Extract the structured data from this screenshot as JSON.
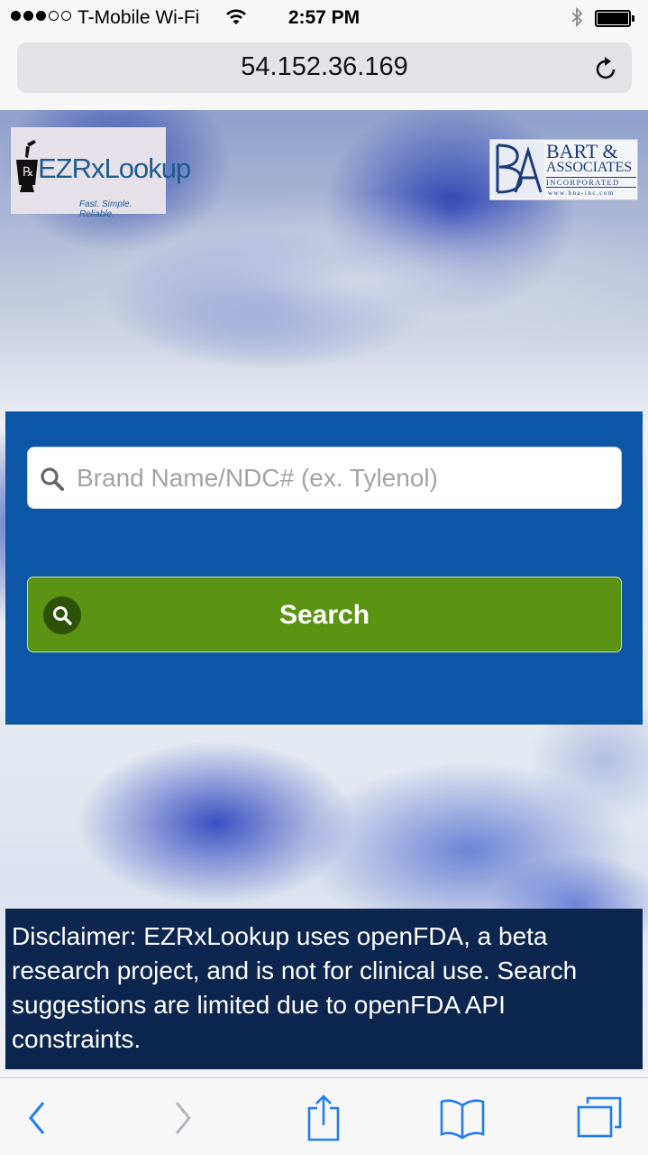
{
  "status_bar": {
    "carrier": "T-Mobile Wi-Fi",
    "time": "2:57 PM",
    "signal_bars_filled": 3,
    "signal_bars_total": 5
  },
  "browser": {
    "url": "54.152.36.169"
  },
  "logos": {
    "ezrx": {
      "name": "EZRxLookup",
      "tagline": "Fast. Simple. Reliable."
    },
    "bart": {
      "line1": "BART &",
      "line2": "ASSOCIATES",
      "line3": "INCORPORATED",
      "line4": "www.bna-inc.com"
    }
  },
  "search": {
    "placeholder": "Brand Name/NDC# (ex. Tylenol)",
    "value": "",
    "button_label": "Search"
  },
  "disclaimer": {
    "text": "Disclaimer: EZRxLookup uses openFDA, a beta research project, and is not for clinical use. Search suggestions are limited due to openFDA API constraints."
  },
  "colors": {
    "search_panel": "#0b56a5",
    "search_button": "#5a9412",
    "disclaimer_bg": "#0c2650",
    "ios_blue": "#1f7cf5"
  },
  "icons": {
    "status": [
      "signal-icon",
      "wifi-icon",
      "bluetooth-icon",
      "battery-icon"
    ],
    "url_bar": [
      "reload-icon"
    ],
    "toolbar": [
      "back-icon",
      "forward-icon",
      "share-icon",
      "bookmarks-icon",
      "tabs-icon"
    ]
  }
}
